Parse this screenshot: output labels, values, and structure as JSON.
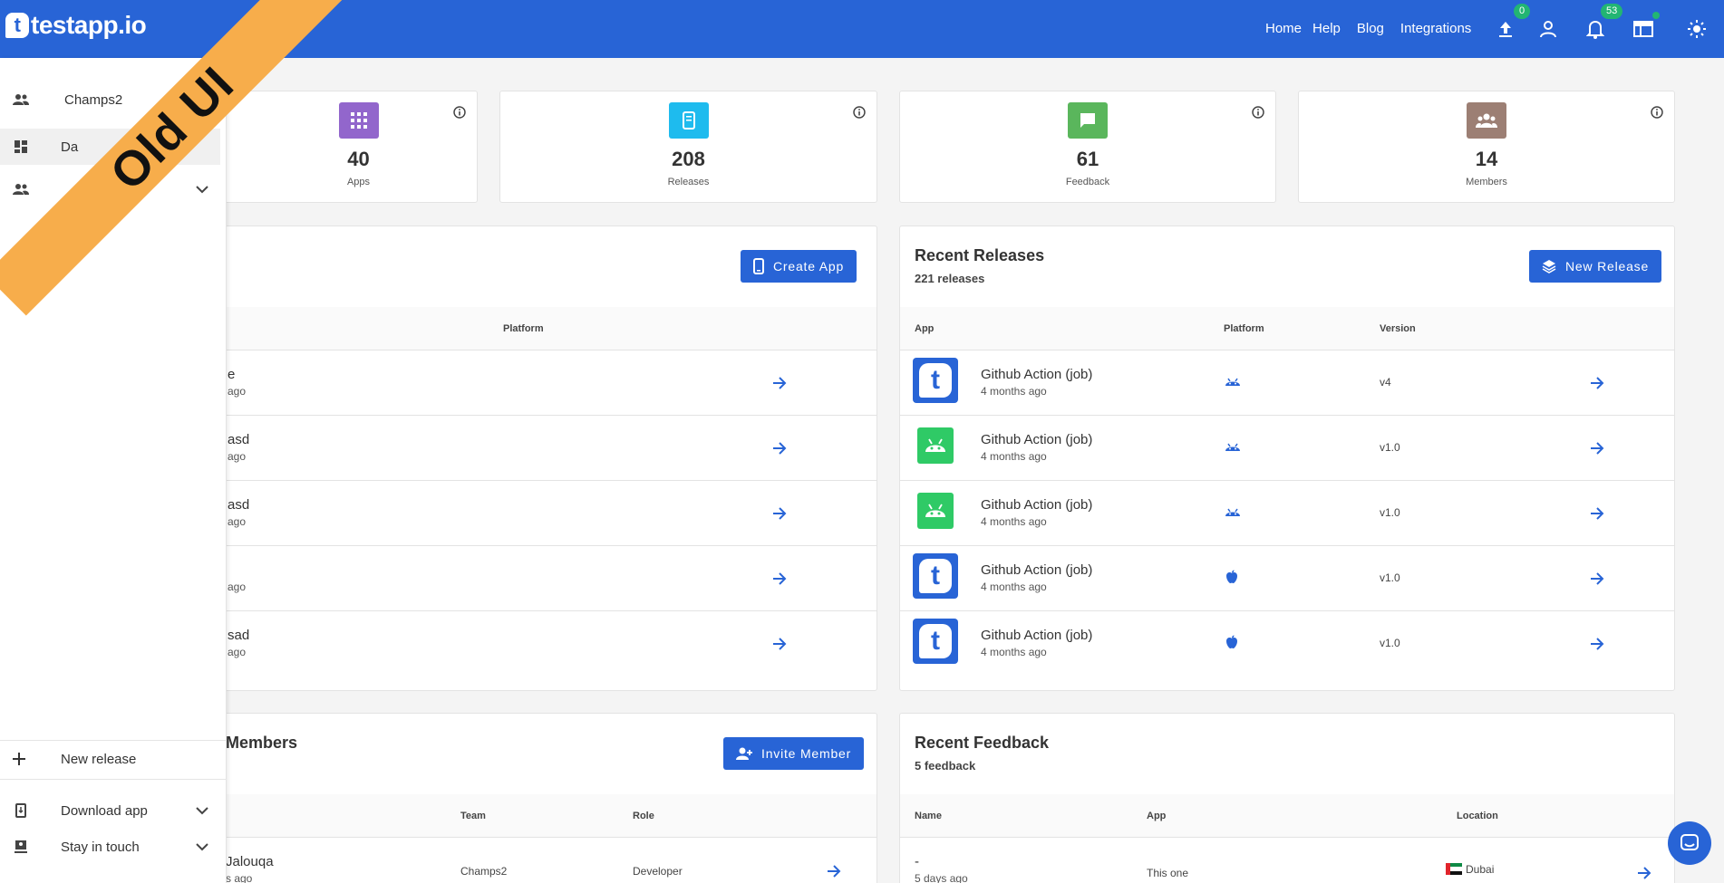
{
  "header": {
    "logo_text": "testapp.io",
    "logo_mark": "t",
    "nav": [
      "Home",
      "Help",
      "Blog",
      "Integrations"
    ],
    "upload_badge": "0",
    "notification_badge": "53",
    "brand_color": "#2864d6"
  },
  "ribbon": {
    "text": "Old UI"
  },
  "sidebar": {
    "team_name": "Champs2",
    "items": [
      {
        "label": "Da",
        "icon": "dashboard-icon"
      },
      {
        "label": "",
        "icon": "team-icon"
      }
    ],
    "bottom": {
      "new_release": "New release",
      "download_app": "Download app",
      "stay_in_touch": "Stay in touch"
    }
  },
  "stats": [
    {
      "value": "40",
      "label": "Apps",
      "color": "#9266cc"
    },
    {
      "value": "208",
      "label": "Releases",
      "color": "#1ebbee"
    },
    {
      "value": "61",
      "label": "Feedback",
      "color": "#5ab65c"
    },
    {
      "value": "14",
      "label": "Members",
      "color": "#9c7f74"
    }
  ],
  "apps_panel": {
    "create_button": "Create App",
    "col_platform": "Platform",
    "rows": [
      {
        "name": "e",
        "time": "ago"
      },
      {
        "name": "asd",
        "time": "ago"
      },
      {
        "name": "asd",
        "time": "ago"
      },
      {
        "name": "",
        "time": "ago"
      },
      {
        "name": "sad",
        "time": "ago"
      }
    ]
  },
  "releases_panel": {
    "title": "Recent Releases",
    "subtitle": "221 releases",
    "new_button": "New Release",
    "cols": {
      "app": "App",
      "platform": "Platform",
      "version": "Version"
    },
    "rows": [
      {
        "app": "Github Action (job)",
        "time": "4 months ago",
        "platform": "android",
        "version": "v4",
        "icon": "testapp"
      },
      {
        "app": "Github Action (job)",
        "time": "4 months ago",
        "platform": "android",
        "version": "v1.0",
        "icon": "android"
      },
      {
        "app": "Github Action (job)",
        "time": "4 months ago",
        "platform": "android",
        "version": "v1.0",
        "icon": "android"
      },
      {
        "app": "Github Action (job)",
        "time": "4 months ago",
        "platform": "ios",
        "version": "v1.0",
        "icon": "testapp"
      },
      {
        "app": "Github Action (job)",
        "time": "4 months ago",
        "platform": "ios",
        "version": "v1.0",
        "icon": "testapp"
      }
    ]
  },
  "members_panel": {
    "title": "Members",
    "invite_button": "Invite Member",
    "cols": {
      "team": "Team",
      "role": "Role"
    },
    "rows": [
      {
        "name": "Jalouqa",
        "time": "s ago",
        "team": "Champs2",
        "role": "Developer"
      }
    ]
  },
  "feedback_panel": {
    "title": "Recent Feedback",
    "subtitle": "5 feedback",
    "cols": {
      "name": "Name",
      "app": "App",
      "location": "Location"
    },
    "rows": [
      {
        "name": "-",
        "time": "5 days ago",
        "app": "This one",
        "location": "Dubai"
      }
    ]
  }
}
